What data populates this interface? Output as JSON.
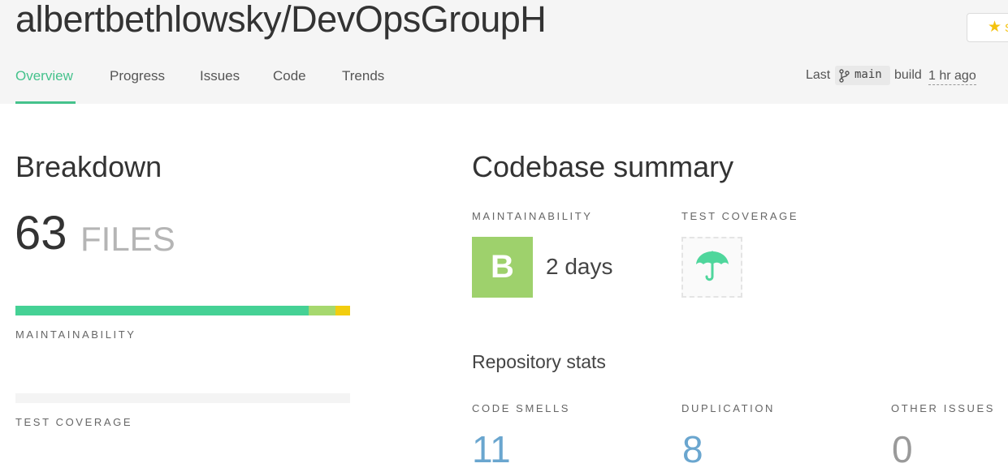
{
  "header": {
    "repo_title": "albertbethlowsky/DevOpsGroupH",
    "star_label": "S",
    "tabs": [
      {
        "label": "Overview",
        "active": true
      },
      {
        "label": "Progress",
        "active": false
      },
      {
        "label": "Issues",
        "active": false
      },
      {
        "label": "Code",
        "active": false
      },
      {
        "label": "Trends",
        "active": false
      }
    ],
    "last_build": {
      "prefix": "Last",
      "branch": "main",
      "word": "build",
      "time": "1 hr ago"
    }
  },
  "breakdown": {
    "title": "Breakdown",
    "files_count": "63",
    "files_unit": "FILES",
    "maintainability_label": "MAINTAINABILITY",
    "maintainability_distribution": [
      {
        "grade": "A",
        "fraction": 0.876,
        "color": "#45d195"
      },
      {
        "grade": "B",
        "fraction": 0.08,
        "color": "#a6d86e"
      },
      {
        "grade": "C",
        "fraction": 0.044,
        "color": "#f2cd0f"
      }
    ],
    "test_coverage_label": "TEST COVERAGE"
  },
  "summary": {
    "title": "Codebase summary",
    "maintainability_label": "MAINTAINABILITY",
    "grade": "B",
    "grade_color": "#9ed16c",
    "debt": "2 days",
    "test_coverage_label": "TEST COVERAGE",
    "coverage_icon": "umbrella-icon",
    "repo_stats_title": "Repository stats",
    "stats": [
      {
        "label": "CODE SMELLS",
        "value": "11",
        "color": "#6aa6cf"
      },
      {
        "label": "DUPLICATION",
        "value": "8",
        "color": "#6aa6cf"
      },
      {
        "label": "OTHER ISSUES",
        "value": "0",
        "color": "#9a9a9a"
      }
    ]
  },
  "colors": {
    "accent": "#45c28c",
    "header_bg": "#f5f5f5",
    "star": "#f4c20d"
  }
}
